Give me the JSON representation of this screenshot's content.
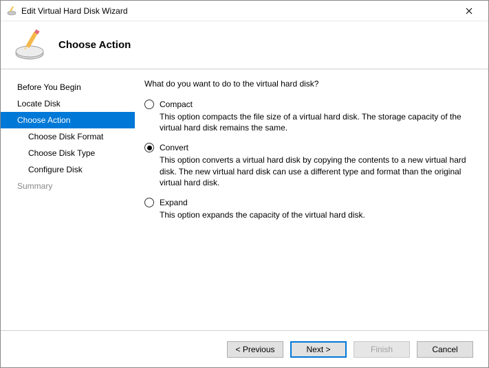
{
  "window": {
    "title": "Edit Virtual Hard Disk Wizard"
  },
  "header": {
    "heading": "Choose Action"
  },
  "sidebar": {
    "items": [
      {
        "label": "Before You Begin",
        "active": false,
        "sub": false,
        "dim": false
      },
      {
        "label": "Locate Disk",
        "active": false,
        "sub": false,
        "dim": false
      },
      {
        "label": "Choose Action",
        "active": true,
        "sub": false,
        "dim": false
      },
      {
        "label": "Choose Disk Format",
        "active": false,
        "sub": true,
        "dim": false
      },
      {
        "label": "Choose Disk Type",
        "active": false,
        "sub": true,
        "dim": false
      },
      {
        "label": "Configure Disk",
        "active": false,
        "sub": true,
        "dim": false
      },
      {
        "label": "Summary",
        "active": false,
        "sub": false,
        "dim": true
      }
    ]
  },
  "content": {
    "prompt": "What do you want to do to the virtual hard disk?",
    "options": [
      {
        "label": "Compact",
        "checked": false,
        "description": "This option compacts the file size of a virtual hard disk. The storage capacity of the virtual hard disk remains the same."
      },
      {
        "label": "Convert",
        "checked": true,
        "description": "This option converts a virtual hard disk by copying the contents to a new virtual hard disk. The new virtual hard disk can use a different type and format than the original virtual hard disk."
      },
      {
        "label": "Expand",
        "checked": false,
        "description": "This option expands the capacity of the virtual hard disk."
      }
    ]
  },
  "footer": {
    "previous": "< Previous",
    "next": "Next >",
    "finish": "Finish",
    "cancel": "Cancel"
  }
}
